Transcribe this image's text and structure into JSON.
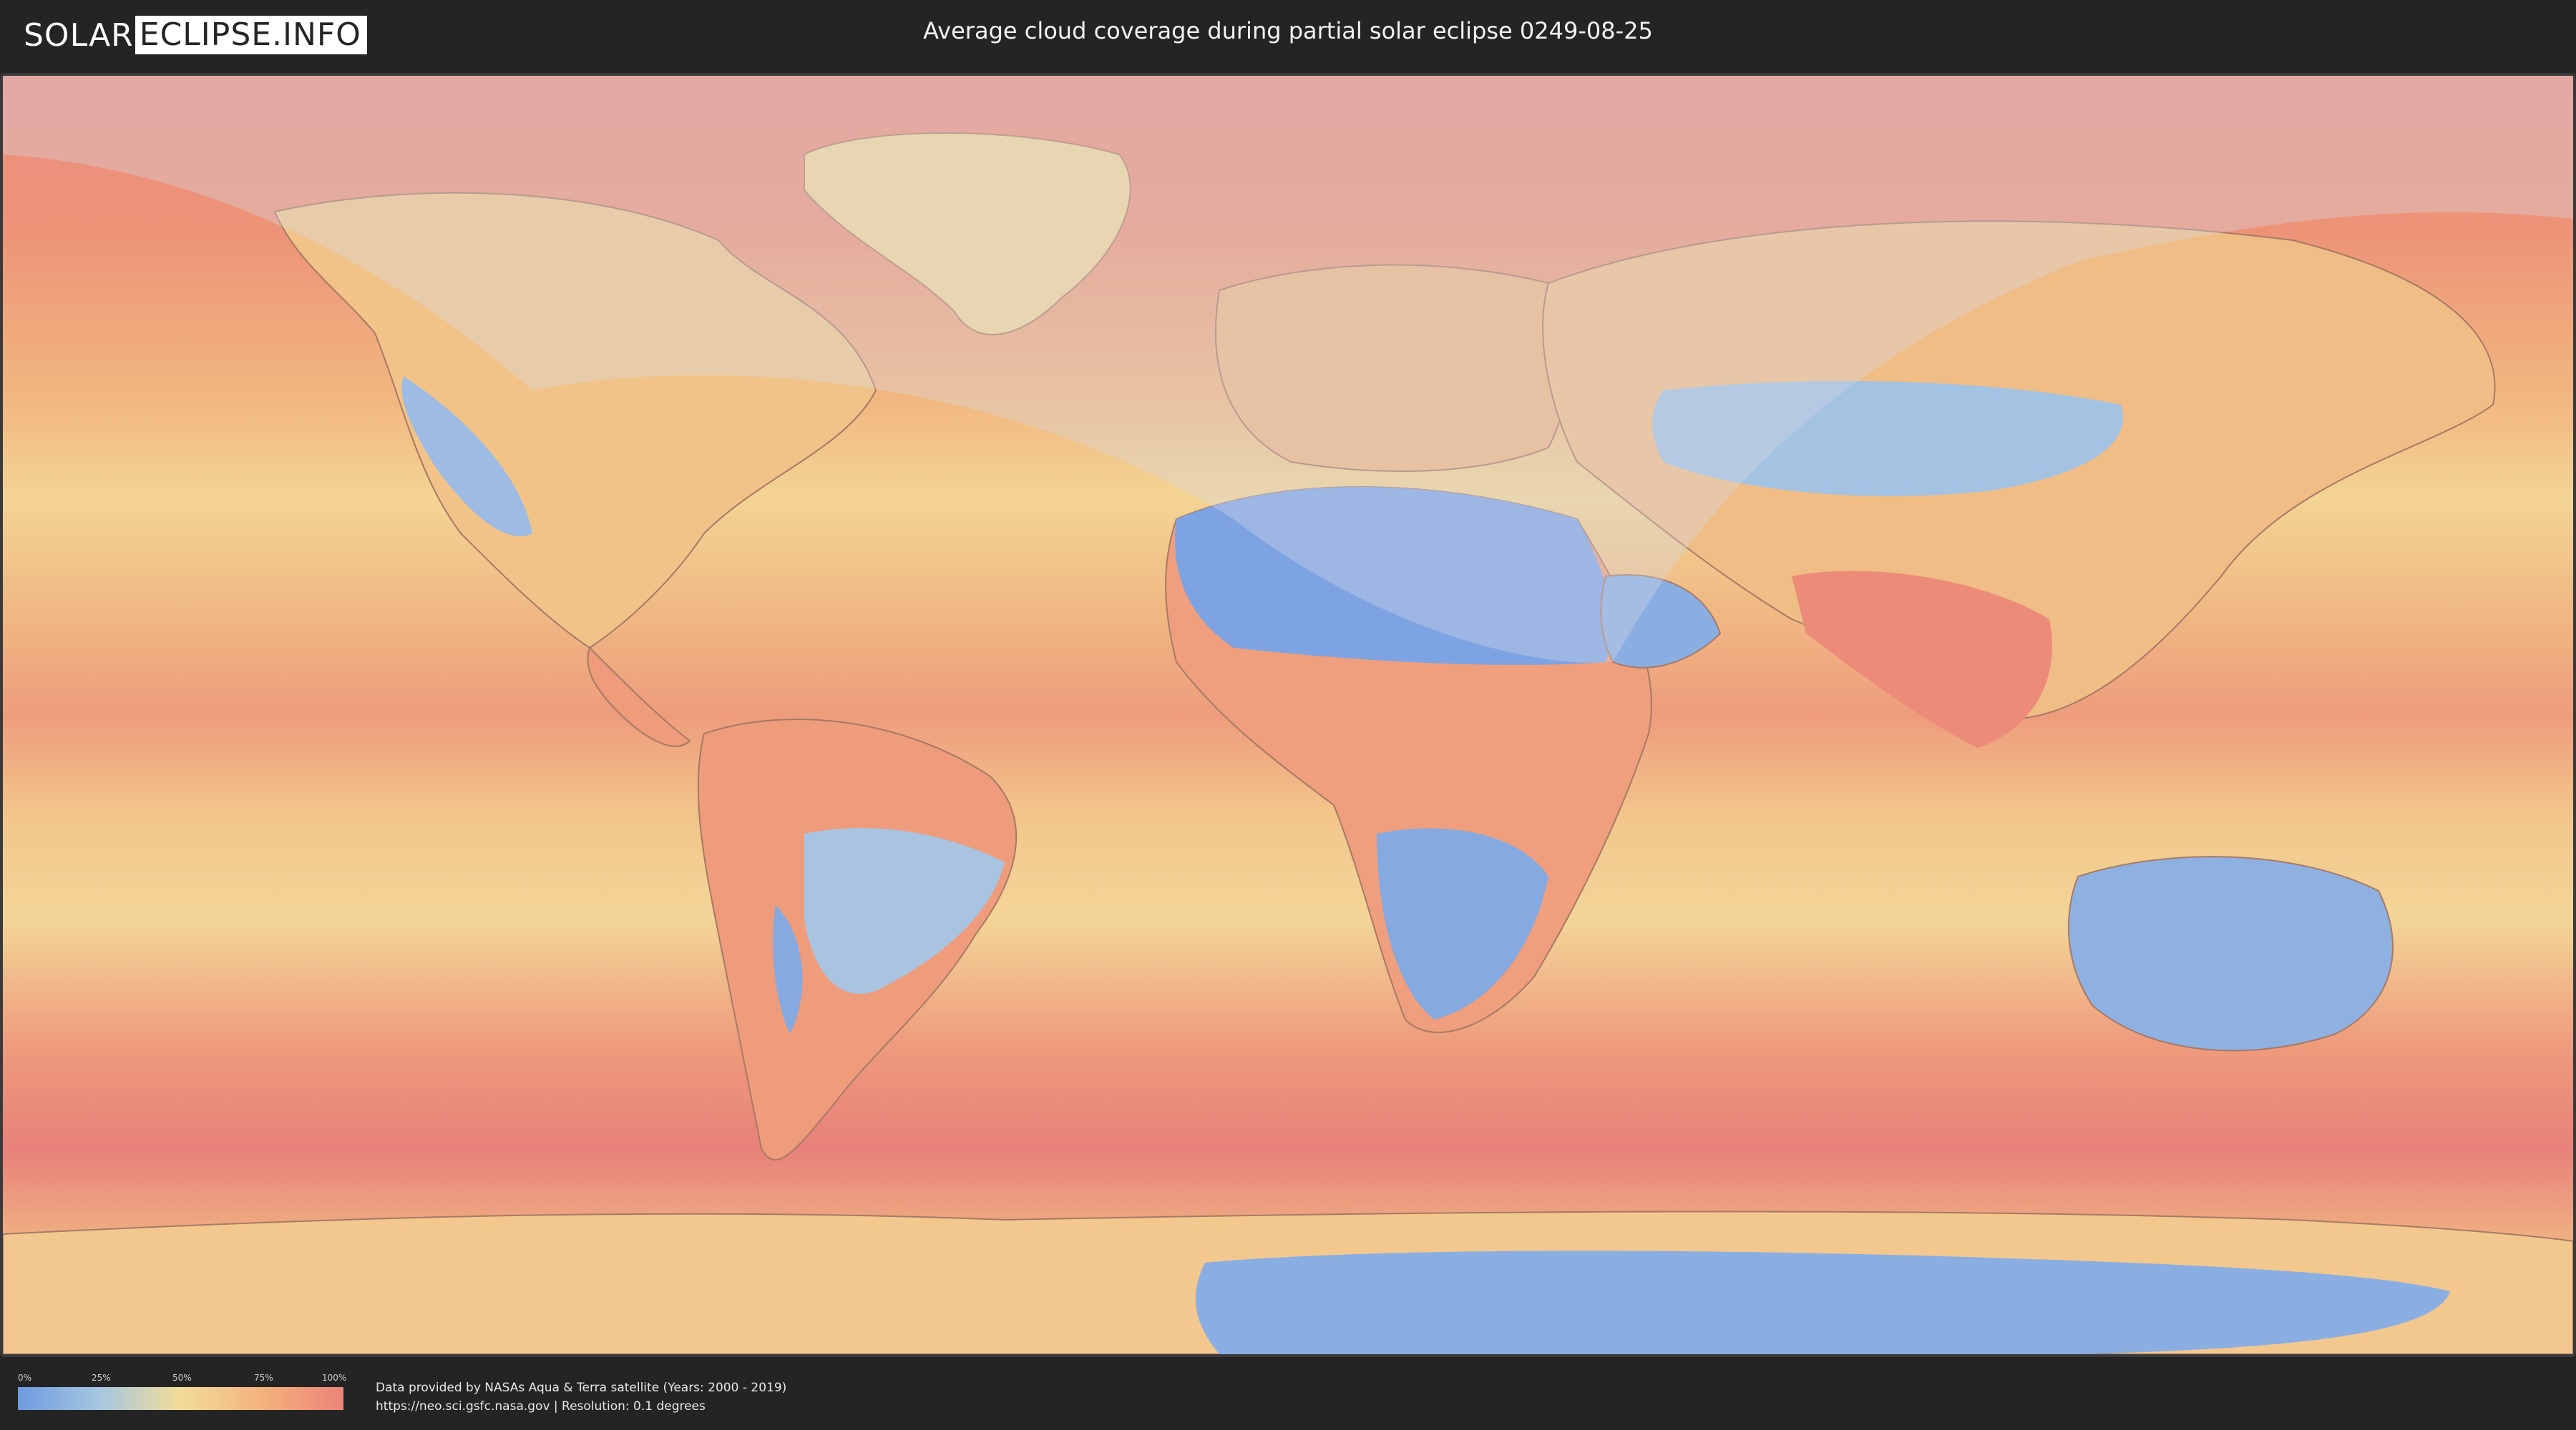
{
  "header": {
    "logo_left": "SOLAR",
    "logo_right": "ECLIPSE.INFO",
    "title": "Average cloud coverage during partial solar eclipse 0249-08-25"
  },
  "legend": {
    "ticks": [
      "0%",
      "25%",
      "50%",
      "75%",
      "100%"
    ],
    "colors": [
      "#6f9be0",
      "#a5c6e0",
      "#f2dd98",
      "#f3b27c",
      "#ec8379"
    ]
  },
  "footer": {
    "credit_line1": "Data provided by NASAs Aqua & Terra satellite (Years: 2000 - 2019)",
    "credit_line2": "https://neo.sci.gsfc.nasa.gov | Resolution: 0.1 degrees"
  },
  "map": {
    "overlay_color": "#d6dbe6",
    "icons": [
      "world-map-icon"
    ]
  }
}
